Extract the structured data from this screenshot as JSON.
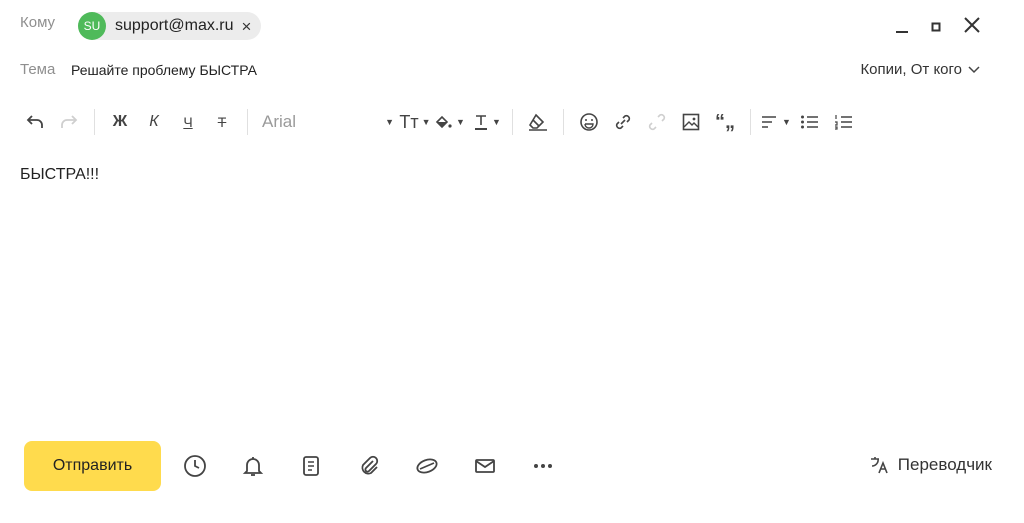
{
  "header": {
    "to_label": "Кому",
    "recipient": {
      "initials": "SU",
      "email": "support@max.ru",
      "remove": "×",
      "avatar_color": "#4fba5a"
    },
    "window_controls": [
      "minimize-icon",
      "restore-icon",
      "close-icon"
    ]
  },
  "subject": {
    "label": "Тема",
    "value": "Решайте проблему БЫСТРА",
    "cc_link": "Копии, От кого"
  },
  "toolbar": {
    "bold": "Ж",
    "italic": "К",
    "underline": "Ч",
    "strike": "Т",
    "font_family": "Arial",
    "font_size_glyph": "Тт",
    "quote_glyph": "“„",
    "icons": [
      "undo-icon",
      "redo-icon",
      "bold-icon",
      "italic-icon",
      "underline-icon",
      "strikethrough-icon",
      "font-size-icon",
      "fill-color-icon",
      "text-color-icon",
      "clear-format-icon",
      "emoji-icon",
      "link-icon",
      "unlink-icon",
      "image-icon",
      "quote-icon",
      "align-icon",
      "bulleted-list-icon",
      "numbered-list-icon"
    ]
  },
  "body": {
    "text": "БЫСТРА!!!"
  },
  "footer": {
    "send_label": "Отправить",
    "accent_color": "#ffdb4d",
    "translator_label": "Переводчик",
    "icons": [
      "schedule-clock-icon",
      "reminder-bell-icon",
      "template-icon",
      "attach-paperclip-icon",
      "disk-icon",
      "envelope-icon",
      "more-dots-icon",
      "translate-icon"
    ]
  }
}
